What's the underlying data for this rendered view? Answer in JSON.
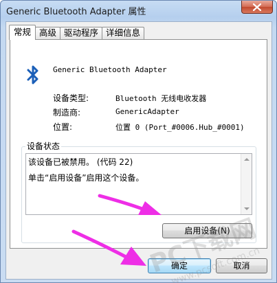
{
  "window": {
    "title": "Generic Bluetooth Adapter 属性"
  },
  "tabs": [
    {
      "label": "常规",
      "active": true
    },
    {
      "label": "高级",
      "active": false
    },
    {
      "label": "驱动程序",
      "active": false
    },
    {
      "label": "详细信息",
      "active": false
    }
  ],
  "device": {
    "name": "Generic Bluetooth Adapter",
    "icon": "bluetooth-icon"
  },
  "properties": [
    {
      "label": "设备类型:",
      "value": "Bluetooth 无线电收发器"
    },
    {
      "label": "制造商:",
      "value": "GenericAdapter"
    },
    {
      "label": "位置:",
      "value": "位置 0 (Port_#0006.Hub_#0001)"
    }
  ],
  "status_group": {
    "label": "设备状态",
    "lines": [
      "该设备已被禁用。 (代码 22)",
      "单击“启用设备”启用这个设备。"
    ]
  },
  "buttons": {
    "enable": "启用设备(N)",
    "ok": "确定",
    "cancel": "取消"
  },
  "annotations": {
    "arrow_color": "#ee2ee6"
  },
  "watermark": {
    "text": "PC下载网",
    "url": "www.pcsoft.com.cn"
  },
  "colors": {
    "titlebar": "#b5cfee",
    "close_button": "#c24a2f",
    "bluetooth_blue": "#1b5fb8"
  }
}
